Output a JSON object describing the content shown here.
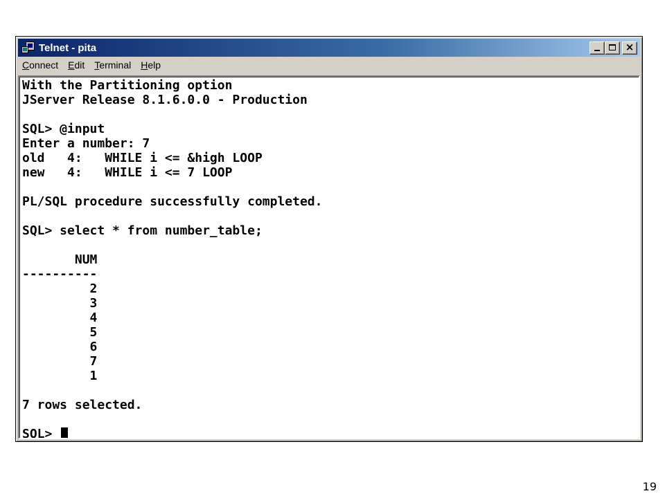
{
  "window": {
    "title": "Telnet - pita",
    "buttons": {
      "minimize_icon": "minimize-icon",
      "maximize_icon": "maximize-icon",
      "close_icon": "close-icon"
    }
  },
  "menu": [
    {
      "mnemonic": "C",
      "rest": "onnect"
    },
    {
      "mnemonic": "E",
      "rest": "dit"
    },
    {
      "mnemonic": "T",
      "rest": "erminal"
    },
    {
      "mnemonic": "H",
      "rest": "elp"
    }
  ],
  "terminal": {
    "lines": [
      "With the Partitioning option",
      "JServer Release 8.1.6.0.0 - Production",
      "",
      "SQL> @input",
      "Enter a number: 7",
      "old   4:   WHILE i <= &high LOOP",
      "new   4:   WHILE i <= 7 LOOP",
      "",
      "PL/SQL procedure successfully completed.",
      "",
      "SQL> select * from number_table;",
      "",
      "       NUM",
      "----------",
      "         2",
      "         3",
      "         4",
      "         5",
      "         6",
      "         7",
      "         1",
      "",
      "7 rows selected.",
      ""
    ],
    "prompt": "SQL> "
  },
  "page_number": "19"
}
